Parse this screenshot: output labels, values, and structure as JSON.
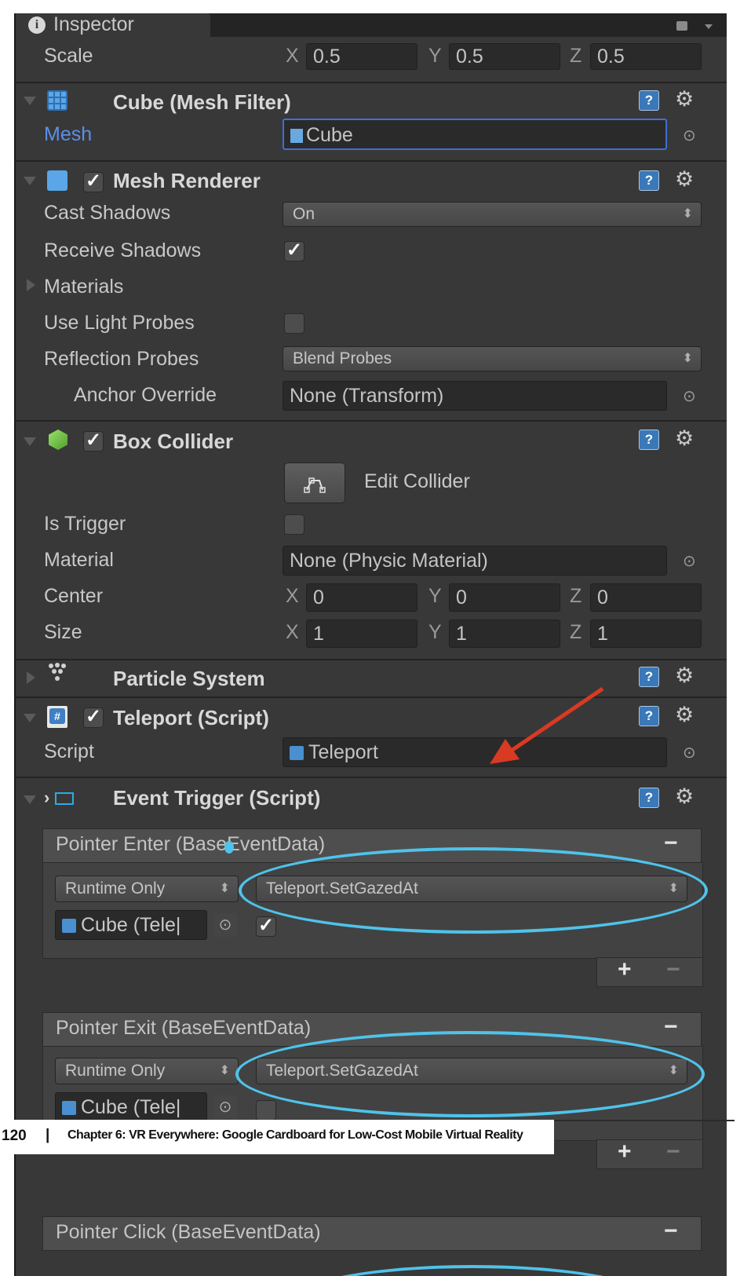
{
  "inspector": {
    "tab_title": "Inspector"
  },
  "transform": {
    "scale_label": "Scale",
    "x": "0.5",
    "y": "0.5",
    "z": "0.5"
  },
  "axes": {
    "x": "X",
    "y": "Y",
    "z": "Z"
  },
  "mesh_filter": {
    "title": "Cube (Mesh Filter)",
    "mesh_label": "Mesh",
    "mesh_value": "Cube"
  },
  "mesh_renderer": {
    "title": "Mesh Renderer",
    "cast_shadows_label": "Cast Shadows",
    "cast_shadows_value": "On",
    "receive_shadows_label": "Receive Shadows",
    "materials_label": "Materials",
    "use_light_probes_label": "Use Light Probes",
    "reflection_probes_label": "Reflection Probes",
    "reflection_probes_value": "Blend Probes",
    "anchor_override_label": "Anchor Override",
    "anchor_override_value": "None (Transform)"
  },
  "box_collider": {
    "title": "Box Collider",
    "edit_label": "Edit Collider",
    "is_trigger_label": "Is Trigger",
    "material_label": "Material",
    "material_value": "None (Physic Material)",
    "center_label": "Center",
    "center": {
      "x": "0",
      "y": "0",
      "z": "0"
    },
    "size_label": "Size",
    "size": {
      "x": "1",
      "y": "1",
      "z": "1"
    }
  },
  "particle_system": {
    "title": "Particle System"
  },
  "teleport": {
    "title": "Teleport (Script)",
    "script_label": "Script",
    "script_value": "Teleport"
  },
  "event_trigger": {
    "title": "Event Trigger (Script)",
    "events": [
      {
        "title": "Pointer Enter (BaseEventData)",
        "mode": "Runtime Only",
        "function": "Teleport.SetGazedAt",
        "object": "Cube (Tele|"
      },
      {
        "title": "Pointer Exit (BaseEventData)",
        "mode": "Runtime Only",
        "function": "Teleport.SetGazedAt",
        "object": "Cube (Tele|"
      },
      {
        "title": "Pointer Click (BaseEventData)"
      }
    ]
  },
  "page_footer": {
    "page_number": "120",
    "separator": "|",
    "chapter": "Chapter 6: VR Everywhere: Google Cardboard for Low-Cost Mobile Virtual Reality"
  },
  "icons": {
    "help": "?",
    "gear": "⚙",
    "target": "⊙",
    "check": "✓",
    "plus": "+",
    "minus": "−",
    "popup_arrow": "⬍"
  },
  "colors": {
    "panel_bg": "#383838",
    "field_bg": "#2a2a2a",
    "highlight_ring": "#4fc3ea",
    "arrow": "#d93a22",
    "mesh_label": "#5c8fe6"
  }
}
